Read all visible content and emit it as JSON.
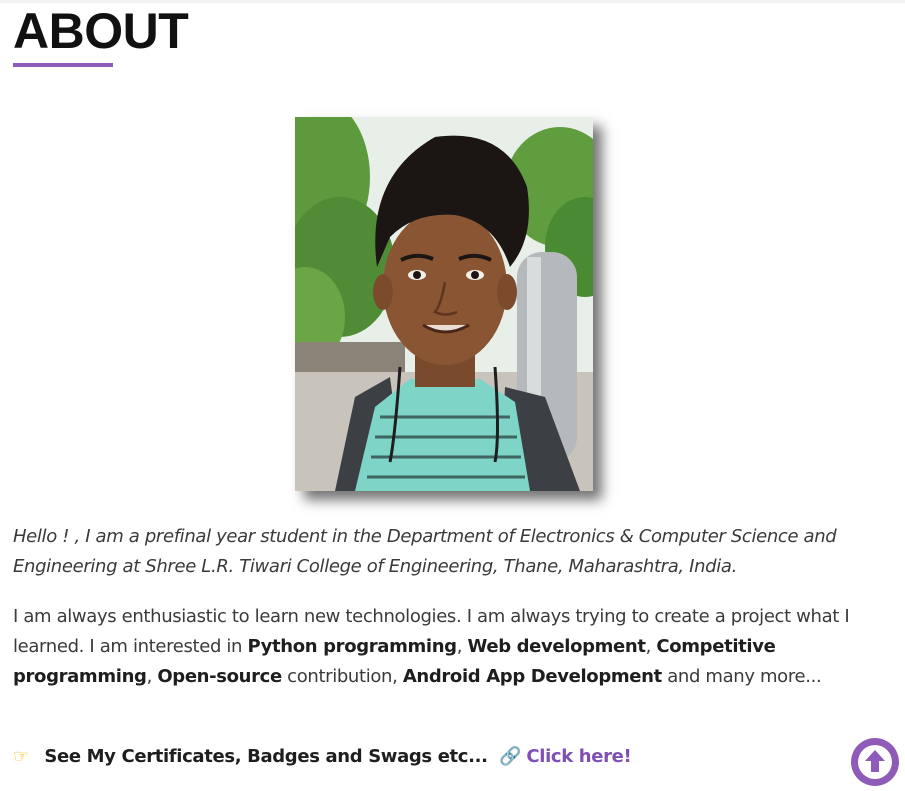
{
  "about": {
    "title": "ABOUT",
    "accent_color": "#8e5bb8",
    "intro_text": "Hello ! , I am a prefinal year student in the Department of Electronics & Computer Science and Engineering at Shree L.R. Tiwari College of Engineering, Thane, Maharashtra, India.",
    "interests": {
      "lead": "I am always enthusiastic to learn new technologies. I am always trying to create a project what I learned. I am interested in ",
      "skill_1": "Python programming",
      "sep_1": ", ",
      "skill_2": "Web development",
      "sep_2": ", ",
      "skill_3": "Competitive programming",
      "sep_3": ", ",
      "skill_4": "Open-source",
      "mid": " contribution, ",
      "skill_5": "Android App Development",
      "tail": " and many more..."
    },
    "certificates": {
      "pointer_icon": "pointing-hand-icon",
      "text": "See My Certificates, Badges and Swags etc...",
      "link_icon": "link-icon",
      "link_label": "Click here!"
    }
  },
  "scroll_top": {
    "icon": "arrow-up-icon",
    "color": "#8e5bb8"
  }
}
